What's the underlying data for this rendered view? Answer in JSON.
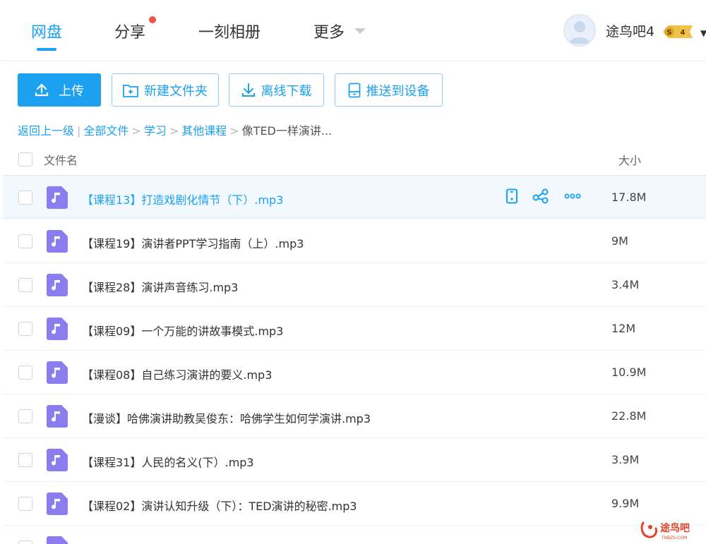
{
  "nav": {
    "tabs": [
      {
        "label": "网盘"
      },
      {
        "label": "分享"
      },
      {
        "label": "一刻相册"
      },
      {
        "label": "更多"
      }
    ],
    "username": "途鸟吧4",
    "vip_level": "4"
  },
  "toolbar": {
    "upload": "上传",
    "new_folder": "新建文件夹",
    "offline_download": "离线下载",
    "push_device": "推送到设备"
  },
  "breadcrumb": {
    "back": "返回上一级",
    "items": [
      "全部文件",
      "学习",
      "其他课程"
    ],
    "current": "像TED一样演讲..."
  },
  "table": {
    "col_name": "文件名",
    "col_size": "大小",
    "rows": [
      {
        "name": "【课程13】打造戏剧化情节（下）.mp3",
        "size": "17.8M"
      },
      {
        "name": "【课程19】演讲者PPT学习指南（上）.mp3",
        "size": "9M"
      },
      {
        "name": "【课程28】演讲声音练习.mp3",
        "size": "3.4M"
      },
      {
        "name": "【课程09】一个万能的讲故事模式.mp3",
        "size": "12M"
      },
      {
        "name": "【课程08】自己练习演讲的要义.mp3",
        "size": "10.9M"
      },
      {
        "name": "【漫谈】哈佛演讲助教吴俊东：哈佛学生如何学演讲.mp3",
        "size": "22.8M"
      },
      {
        "name": "【课程31】人民的名义(下）.mp3",
        "size": "3.9M"
      },
      {
        "name": "【课程02】演讲认知升级（下）：TED演讲的秘密.mp3",
        "size": "9.9M"
      }
    ]
  },
  "colors": {
    "accent": "#1ba1f0",
    "file_icon": "#8b7cf0",
    "badge_red": "#f2514b"
  },
  "watermark": {
    "text": "途鸟吧",
    "sub": "TNBZS.COM"
  }
}
